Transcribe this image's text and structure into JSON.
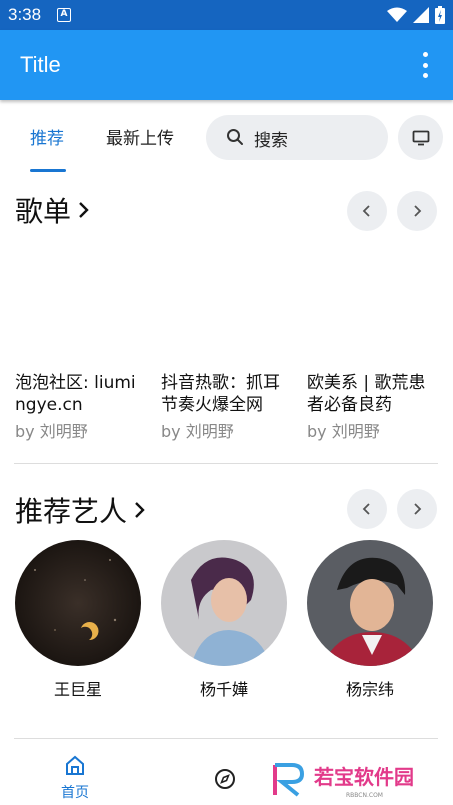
{
  "status_bar": {
    "time": "3:38",
    "notification": "A"
  },
  "app_bar": {
    "title": "Title"
  },
  "tabs": [
    {
      "label": "推荐",
      "active": true
    },
    {
      "label": "最新上传",
      "active": false
    }
  ],
  "search": {
    "placeholder": "搜索"
  },
  "playlists_section": {
    "title": "歌单",
    "items": [
      {
        "name": "泡泡社区: liumingye.cn",
        "author": "by 刘明野"
      },
      {
        "name": "抖音热歌：抓耳节奏火爆全网",
        "author": "by 刘明野"
      },
      {
        "name": "欧美系 | 歌荒患者必备良药",
        "author": "by 刘明野"
      }
    ]
  },
  "artists_section": {
    "title": "推荐艺人",
    "items": [
      {
        "name": "王巨星"
      },
      {
        "name": "杨千嬅"
      },
      {
        "name": "杨宗纬"
      }
    ]
  },
  "bottom_nav": {
    "home_label": "首页"
  },
  "watermark": {
    "brand": "若宝软件园",
    "url": "RBBCN.COM"
  },
  "colors": {
    "status_bar": "#1565c0",
    "app_bar": "#2196f3",
    "accent": "#1976d2"
  }
}
